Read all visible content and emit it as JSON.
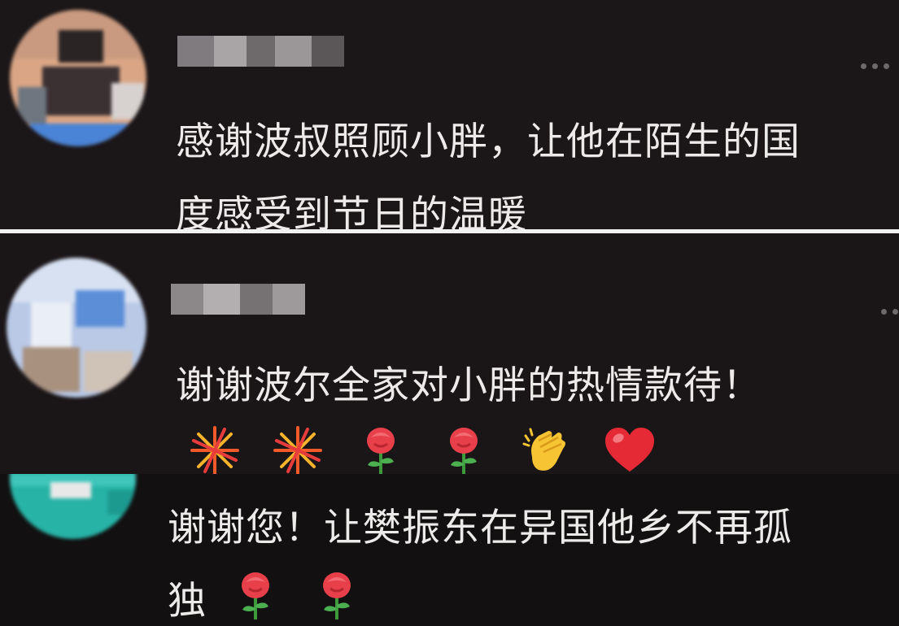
{
  "comments": [
    {
      "text_lines": [
        "感谢波叔照顾小胖，让他在陌生的国",
        "度感受到节日的温暖"
      ],
      "more_icon": "ellipsis-icon",
      "avatar": "blurred-avatar"
    },
    {
      "text_lines": [
        "谢谢波尔全家对小胖的热情款待！"
      ],
      "emojis": [
        "fireworks",
        "fireworks",
        "rose",
        "rose",
        "clapping-hands",
        "red-heart"
      ],
      "more_icon": "ellipsis-icon",
      "avatar": "blurred-avatar"
    },
    {
      "text_lines": [
        "谢谢您！让樊振东在异国他乡不再孤",
        "独"
      ],
      "emojis": [
        "rose",
        "rose"
      ],
      "avatar": "blurred-avatar"
    }
  ],
  "colors": {
    "background": "#1b1618",
    "text": "#ecebea",
    "divider": "#f2f2f2",
    "username_blur": "#8a8689"
  }
}
